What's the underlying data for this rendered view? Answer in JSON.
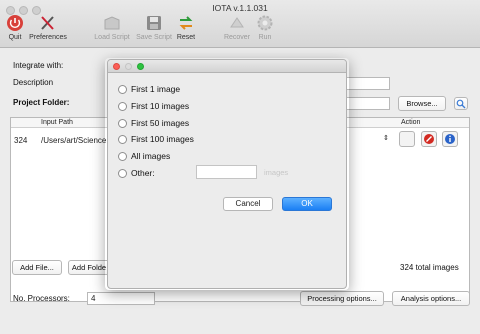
{
  "window": {
    "title": "IOTA v.1.1.031"
  },
  "toolbar": {
    "quit": "Quit",
    "preferences": "Preferences",
    "load_script": "Load Script",
    "save_script": "Save Script",
    "reset": "Reset",
    "recover": "Recover",
    "run": "Run"
  },
  "form": {
    "integrate_label": "Integrate with:",
    "description_label": "Description",
    "project_folder_label": "Project Folder:",
    "browse": "Browse...",
    "processors_label": "No. Processors:",
    "processors_value": "4"
  },
  "table": {
    "col_input_path": "Input Path",
    "col_action": "Action",
    "row": {
      "count": "324",
      "path": "/Users/art/Science,"
    }
  },
  "bottom": {
    "add_file": "Add File...",
    "add_folder": "Add Folde",
    "total": "324 total images",
    "processing_options": "Processing options...",
    "analysis_options": "Analysis options..."
  },
  "dialog": {
    "options": [
      {
        "label": "First 1 image"
      },
      {
        "label": "First 10 images"
      },
      {
        "label": "First 50 images"
      },
      {
        "label": "First 100 images"
      },
      {
        "label": "All images"
      },
      {
        "label": "Other:"
      }
    ],
    "other_unit": "images",
    "cancel": "Cancel",
    "ok": "OK"
  },
  "colors": {
    "accent": "#1b7ff4",
    "close_dot": "#fc5f57",
    "min_dot": "#dcdcdc",
    "max_dot": "#2fc241"
  }
}
